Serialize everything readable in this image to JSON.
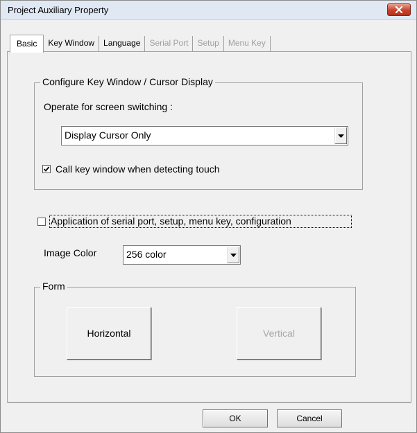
{
  "window": {
    "title": "Project Auxiliary Property"
  },
  "tabs": [
    {
      "label": "Basic",
      "state": "active"
    },
    {
      "label": "Key Window",
      "state": "enabled"
    },
    {
      "label": "Language",
      "state": "enabled"
    },
    {
      "label": "Serial Port",
      "state": "disabled"
    },
    {
      "label": "Setup",
      "state": "disabled"
    },
    {
      "label": "Menu Key",
      "state": "disabled"
    }
  ],
  "key_window_group": {
    "title": "Configure Key Window / Cursor Display",
    "screen_switch_label": "Operate for screen switching :",
    "screen_switch_value": "Display Cursor Only",
    "call_key_window": {
      "label": "Call key window when detecting touch",
      "checked": true
    }
  },
  "serial_config": {
    "label": "Application of serial port, setup, menu key, configuration",
    "checked": false
  },
  "image_color": {
    "label": "Image Color",
    "value": "256 color"
  },
  "form_group": {
    "title": "Form",
    "horizontal_label": "Horizontal",
    "vertical_label": "Vertical"
  },
  "buttons": {
    "ok": "OK",
    "cancel": "Cancel"
  },
  "icons": {
    "close": "close-icon",
    "dropdown": "chevron-down-icon",
    "check": "checkmark-icon"
  },
  "colors": {
    "close_button": "#c6422c",
    "disabled_text": "#a0a0a0"
  }
}
